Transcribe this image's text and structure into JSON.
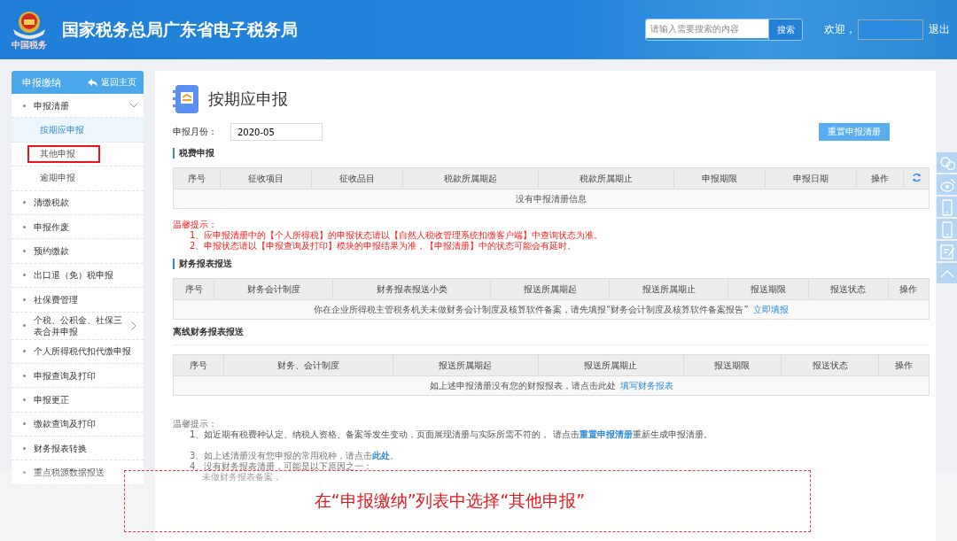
{
  "header": {
    "title": "国家税务总局广东省电子税务局",
    "logo_caption": "中国税务",
    "search": {
      "placeholder": "请输入需要搜索的内容",
      "button": "搜索"
    },
    "welcome": "欢迎，",
    "logout": "退出"
  },
  "sidebar": {
    "title": "申报缴纳",
    "back": "返回主页",
    "items": [
      {
        "label": "申报清册",
        "expanded": true,
        "selected": false,
        "children": [
          {
            "label": "按期应申报",
            "selected": true,
            "highlighted": false
          },
          {
            "label": "其他申报",
            "selected": false,
            "highlighted": true
          },
          {
            "label": "逾期申报",
            "selected": false,
            "highlighted": false
          }
        ]
      },
      {
        "label": "清缴税款",
        "selected": false
      },
      {
        "label": "申报作废",
        "selected": false
      },
      {
        "label": "预约缴款",
        "selected": false
      },
      {
        "label": "出口退（免）税申报",
        "selected": false
      },
      {
        "label": "社保费管理",
        "selected": false
      },
      {
        "label": "个税、公积金、社保三表合并申报",
        "expanded": false,
        "selected": false
      },
      {
        "label": "个人所得税代扣代缴申报",
        "selected": false
      },
      {
        "label": "申报查询及打印",
        "selected": false
      },
      {
        "label": "申报更正",
        "selected": false
      },
      {
        "label": "缴款查询及打印",
        "selected": false
      },
      {
        "label": "财务报表转换",
        "selected": false
      },
      {
        "label": "重点税源数据报送",
        "selected": false
      }
    ]
  },
  "page": {
    "title": "按期应申报",
    "month_label": "申报月份：",
    "month": "2020-05",
    "reset_button": "重置申报清册"
  },
  "sections": [
    {
      "title": "税费申报",
      "marker": true,
      "columns": [
        "序号",
        "征收项目",
        "征收品目",
        "税款所属期起",
        "税款所属期止",
        "申报期限",
        "申报日期",
        "操作"
      ],
      "refresh": true,
      "empty": {
        "text": "没有申报清册信息"
      },
      "notice": {
        "title": "温馨提示：",
        "lines": [
          "1、应申报清册中的【个人所得税】的申报状态请以【自然人税收管理系统扣缴客户端】中查询状态为准。",
          "2、申报状态请以【申报查询及打印】模块的申报结果为准，【申报清册】中的状态可能会有延时。"
        ]
      }
    },
    {
      "title": "财务报表报送",
      "marker": true,
      "columns": [
        "序号",
        "财务会计制度",
        "财务报表报送小类",
        "报送所属期起",
        "报送所属期止",
        "报送期限",
        "报送状态",
        "操作"
      ],
      "empty": {
        "text": "你在企业所得税主管税务机关未做财务会计制度及核算软件备案，请先填报“财务会计制度及核算软件备案报告”",
        "link": "立即填报"
      }
    },
    {
      "title": "离线财务报表报送",
      "marker": false,
      "columns": [
        "序号",
        "财务、会计制度",
        "报送所属期起",
        "报送所属期止",
        "报送期限",
        "报送状态",
        "操作"
      ],
      "empty": {
        "text": "如上述申报清册没有您的财报报表，请点击此处",
        "link": "填写财务报表"
      }
    }
  ],
  "tips": {
    "title": "温馨提示：",
    "lines": [
      {
        "kind": "item",
        "text": "1、如近期有税费种认定、纳税人资格、备案等发生变动，页面展现清册与实际所需不符的， 请点击",
        "link": "重置申报清册",
        "after": "重新生成申报清册。",
        "faded": false
      },
      {
        "kind": "item",
        "text": "3、如上述清册没有您申报的常用税种，请点击",
        "link": "此处",
        "after": "。",
        "faded": true
      },
      {
        "kind": "item",
        "text": "4、没有财务报表清册，可能是以下原因之一：",
        "faded": true
      },
      {
        "kind": "sub",
        "text": "未做财务报表备案，",
        "faded": true
      }
    ]
  },
  "annotation": {
    "text": "在“申报缴纳”列表中选择“其他申报”"
  }
}
